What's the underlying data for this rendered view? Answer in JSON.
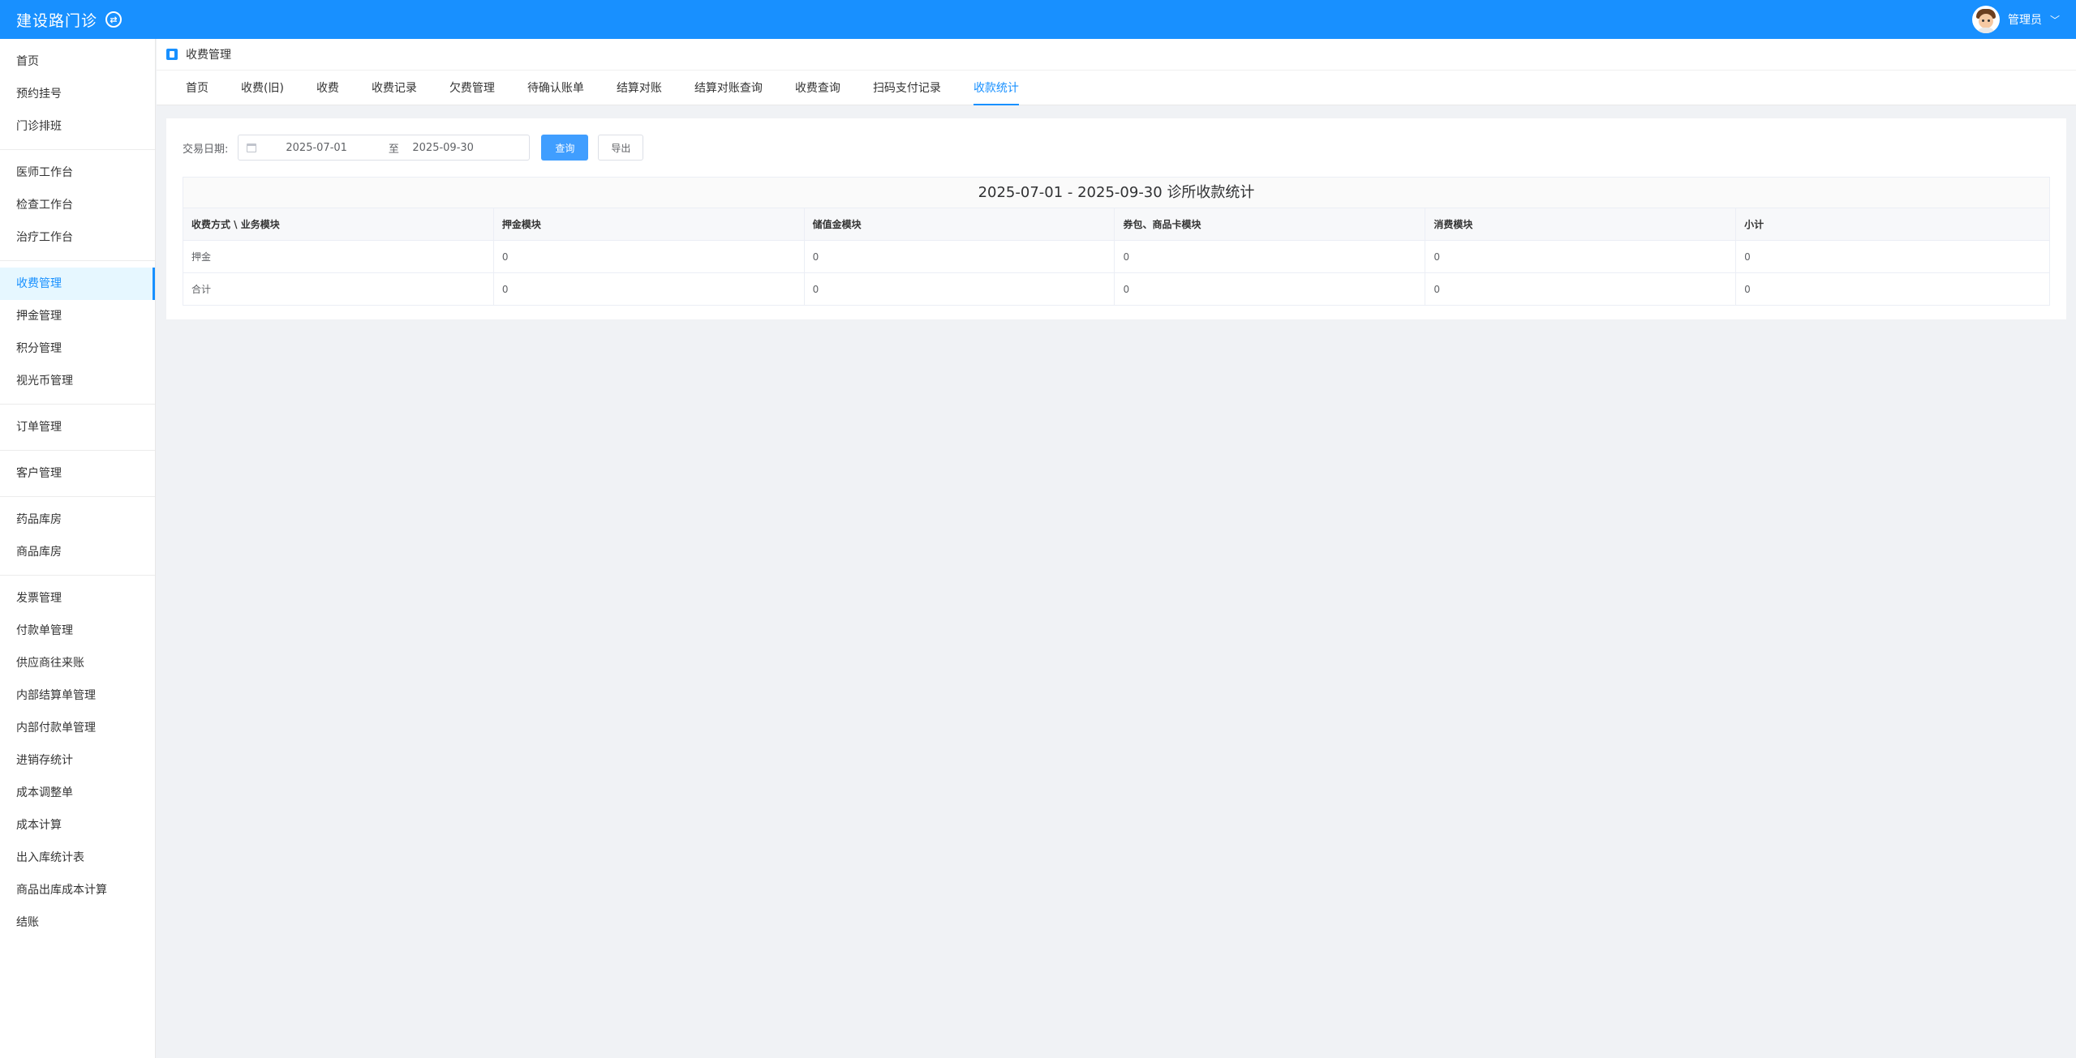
{
  "header": {
    "title": "建设路门诊",
    "switch_icon": "swap-icon",
    "user_name": "管理员"
  },
  "sidebar": {
    "groups": [
      [
        "首页",
        "预约挂号",
        "门诊排班"
      ],
      [
        "医师工作台",
        "检查工作台",
        "治疗工作台"
      ],
      [
        "收费管理",
        "押金管理",
        "积分管理",
        "视光币管理"
      ],
      [
        "订单管理"
      ],
      [
        "客户管理"
      ],
      [
        "药品库房",
        "商品库房"
      ],
      [
        "发票管理",
        "付款单管理",
        "供应商往来账",
        "内部结算单管理",
        "内部付款单管理",
        "进销存统计",
        "成本调整单",
        "成本计算",
        "出入库统计表",
        "商品出库成本计算",
        "结账"
      ]
    ],
    "active": "收费管理"
  },
  "page": {
    "breadcrumb": "收费管理",
    "tabs": [
      "首页",
      "收费(旧)",
      "收费",
      "收费记录",
      "欠费管理",
      "待确认账单",
      "结算对账",
      "结算对账查询",
      "收费查询",
      "扫码支付记录",
      "收款统计"
    ],
    "active_tab": "收款统计"
  },
  "filter": {
    "label": "交易日期:",
    "start": "2025-07-01",
    "separator": "至",
    "end": "2025-09-30",
    "query_button": "查询",
    "export_button": "导出"
  },
  "table": {
    "caption": "2025-07-01 - 2025-09-30 诊所收款统计",
    "columns": [
      "收费方式 \\ 业务模块",
      "押金模块",
      "储值金模块",
      "券包、商品卡模块",
      "消费模块",
      "小计"
    ],
    "rows": [
      [
        "押金",
        "0",
        "0",
        "0",
        "0",
        "0"
      ],
      [
        "合计",
        "0",
        "0",
        "0",
        "0",
        "0"
      ]
    ]
  },
  "colors": {
    "primary": "#1890ff",
    "button_primary": "#409eff",
    "background": "#f0f2f5"
  }
}
